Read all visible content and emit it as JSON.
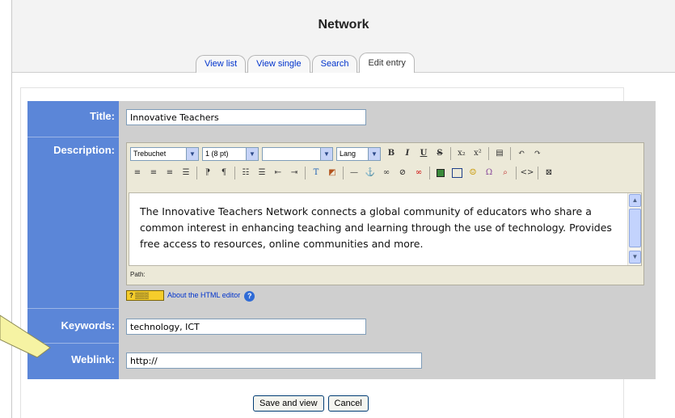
{
  "page": {
    "title": "Network"
  },
  "tabs": [
    {
      "label": "View list",
      "active": false
    },
    {
      "label": "View single",
      "active": false
    },
    {
      "label": "Search",
      "active": false
    },
    {
      "label": "Edit entry",
      "active": true
    }
  ],
  "form": {
    "title_label": "Title:",
    "title_value": "Innovative Teachers",
    "description_label": "Description:",
    "keywords_label": "Keywords:",
    "keywords_value": "technology, ICT",
    "weblink_label": "Weblink:",
    "weblink_value": "http://"
  },
  "editor": {
    "font_family": "Trebuchet",
    "font_size": "1 (8 pt)",
    "style": "",
    "lang": "Lang",
    "body_text": "The Innovative Teachers Network connects a global community of educators who share a common interest in enhancing teaching and learning through the use of technology.  Provides free access to resources, online communities and more.",
    "path_label": "Path:",
    "help_link": "About the HTML editor"
  },
  "buttons": {
    "save": "Save and view",
    "cancel": "Cancel"
  },
  "colors": {
    "label_column": "#5b86d8",
    "form_panel": "#cfcfcf",
    "link": "#0033cc",
    "callout": "#f6f3a3"
  }
}
